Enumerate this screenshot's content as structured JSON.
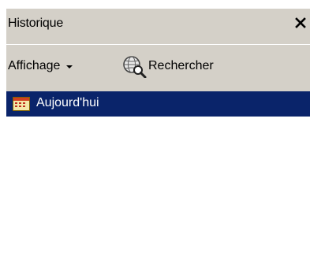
{
  "panel": {
    "title": "Historique",
    "close_icon": "close-icon"
  },
  "toolbar": {
    "view_label": "Affichage",
    "search_label": "Rechercher",
    "search_icon": "search-globe-icon"
  },
  "history": {
    "items": [
      {
        "label": "Aujourd'hui",
        "icon": "calendar-icon",
        "selected": true
      }
    ]
  },
  "colors": {
    "chrome": "#d4d0c8",
    "selection": "#0a246a",
    "selection_text": "#ffffff"
  }
}
